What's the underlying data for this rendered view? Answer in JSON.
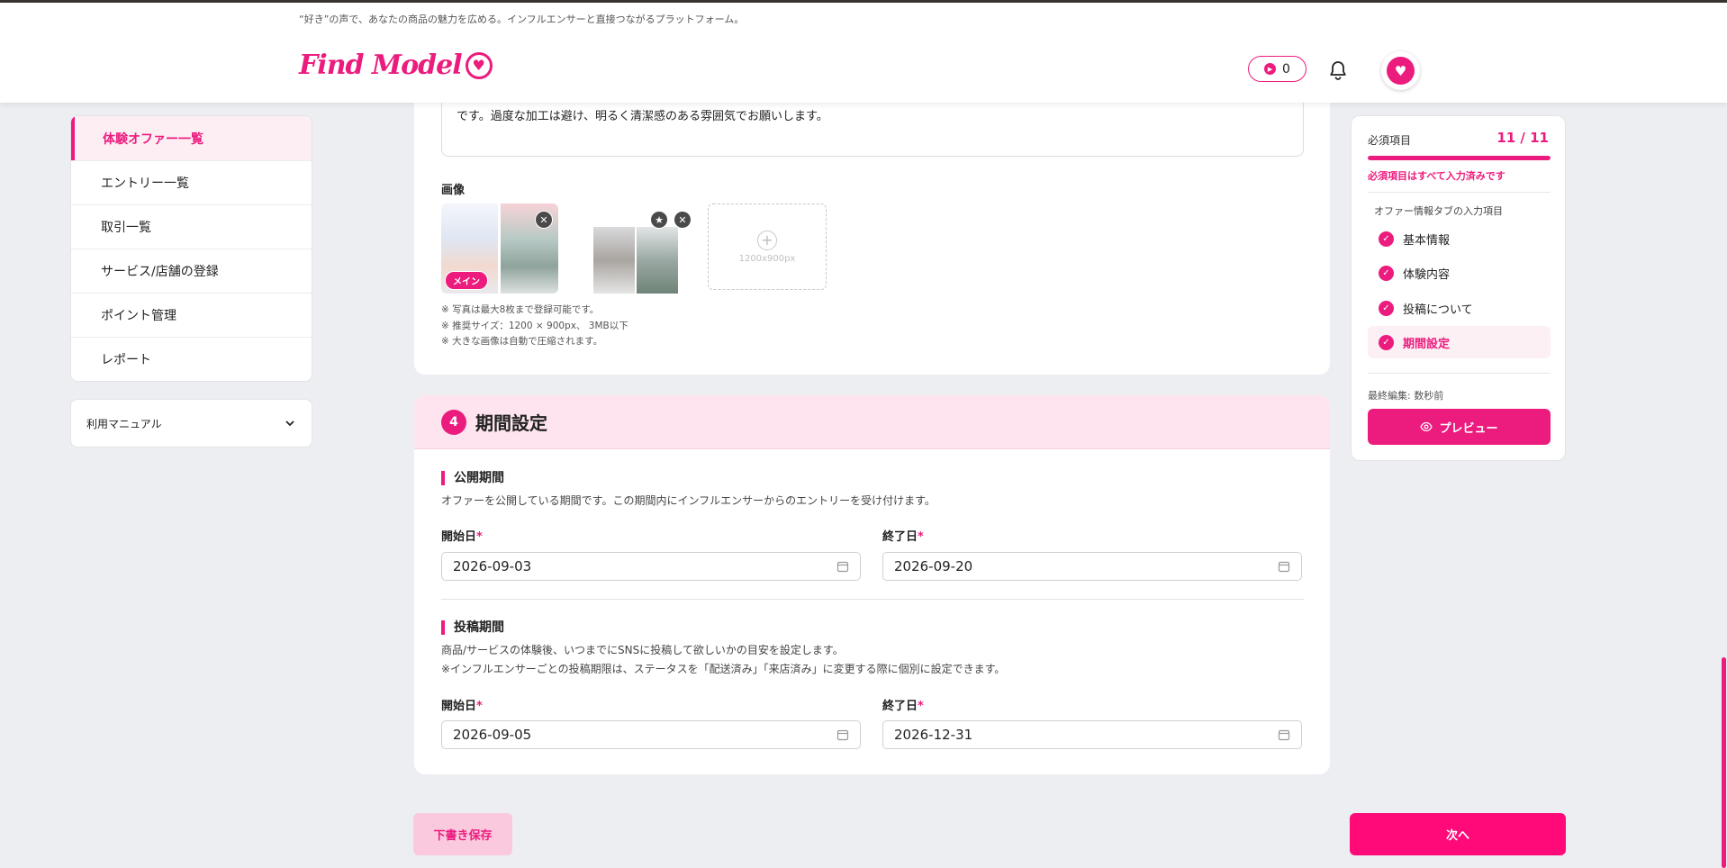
{
  "header": {
    "tagline": "“好き”の声で、あなたの商品の魅力を広める。インフルエンサーと直接つながるプラットフォーム。",
    "logo_text": "Find Model",
    "points": "0"
  },
  "sidebar": {
    "items": [
      {
        "label": "体験オファー一覧"
      },
      {
        "label": "エントリー一覧"
      },
      {
        "label": "取引一覧"
      },
      {
        "label": "サービス/店舗の登録"
      },
      {
        "label": "ポイント管理"
      },
      {
        "label": "レポート"
      }
    ],
    "manual_label": "利用マニュアル"
  },
  "images_section": {
    "textarea_tail": "です。過度な加工は避け、明るく清潔感のある雰囲気でお願いします。",
    "label": "画像",
    "main_badge": "メイン",
    "add_size": "1200x900px",
    "notes": [
      "※ 写真は最大8枚まで登録可能です。",
      "※ 推奨サイズ：1200 × 900px、 3MB以下",
      "※ 大きな画像は自動で圧縮されます。"
    ]
  },
  "period_section": {
    "number": "4",
    "title": "期間設定",
    "public": {
      "title": "公開期間",
      "desc": "オファーを公開している期間です。この期間内にインフルエンサーからのエントリーを受け付けます。",
      "start_label": "開始日",
      "end_label": "終了日",
      "start_value": "2026-09-03",
      "end_value": "2026-09-20"
    },
    "post": {
      "title": "投稿期間",
      "desc1": "商品/サービスの体験後、いつまでにSNSに投稿して欲しいかの目安を設定します。",
      "desc2": "※インフルエンサーごとの投稿期限は、ステータスを「配送済み」「来店済み」に変更する際に個別に設定できます。",
      "start_label": "開始日",
      "end_label": "終了日",
      "start_value": "2026-09-05",
      "end_value": "2026-12-31"
    },
    "required_mark": "*"
  },
  "progress": {
    "label": "必須項目",
    "count": "11 / 11",
    "fraction": 1.0,
    "done_text": "必須項目はすべて入力済みです",
    "section_title": "オファー情報タブの入力項目",
    "items": [
      {
        "label": "基本情報"
      },
      {
        "label": "体験内容"
      },
      {
        "label": "投稿について"
      },
      {
        "label": "期間設定"
      }
    ],
    "last_edited": "最終編集: 数秒前",
    "preview_label": "プレビュー"
  },
  "footer": {
    "draft_label": "下書き保存",
    "next_label": "次へ"
  },
  "colors": {
    "accent": "#ec1c7e",
    "accent_light": "#fde4ee"
  }
}
